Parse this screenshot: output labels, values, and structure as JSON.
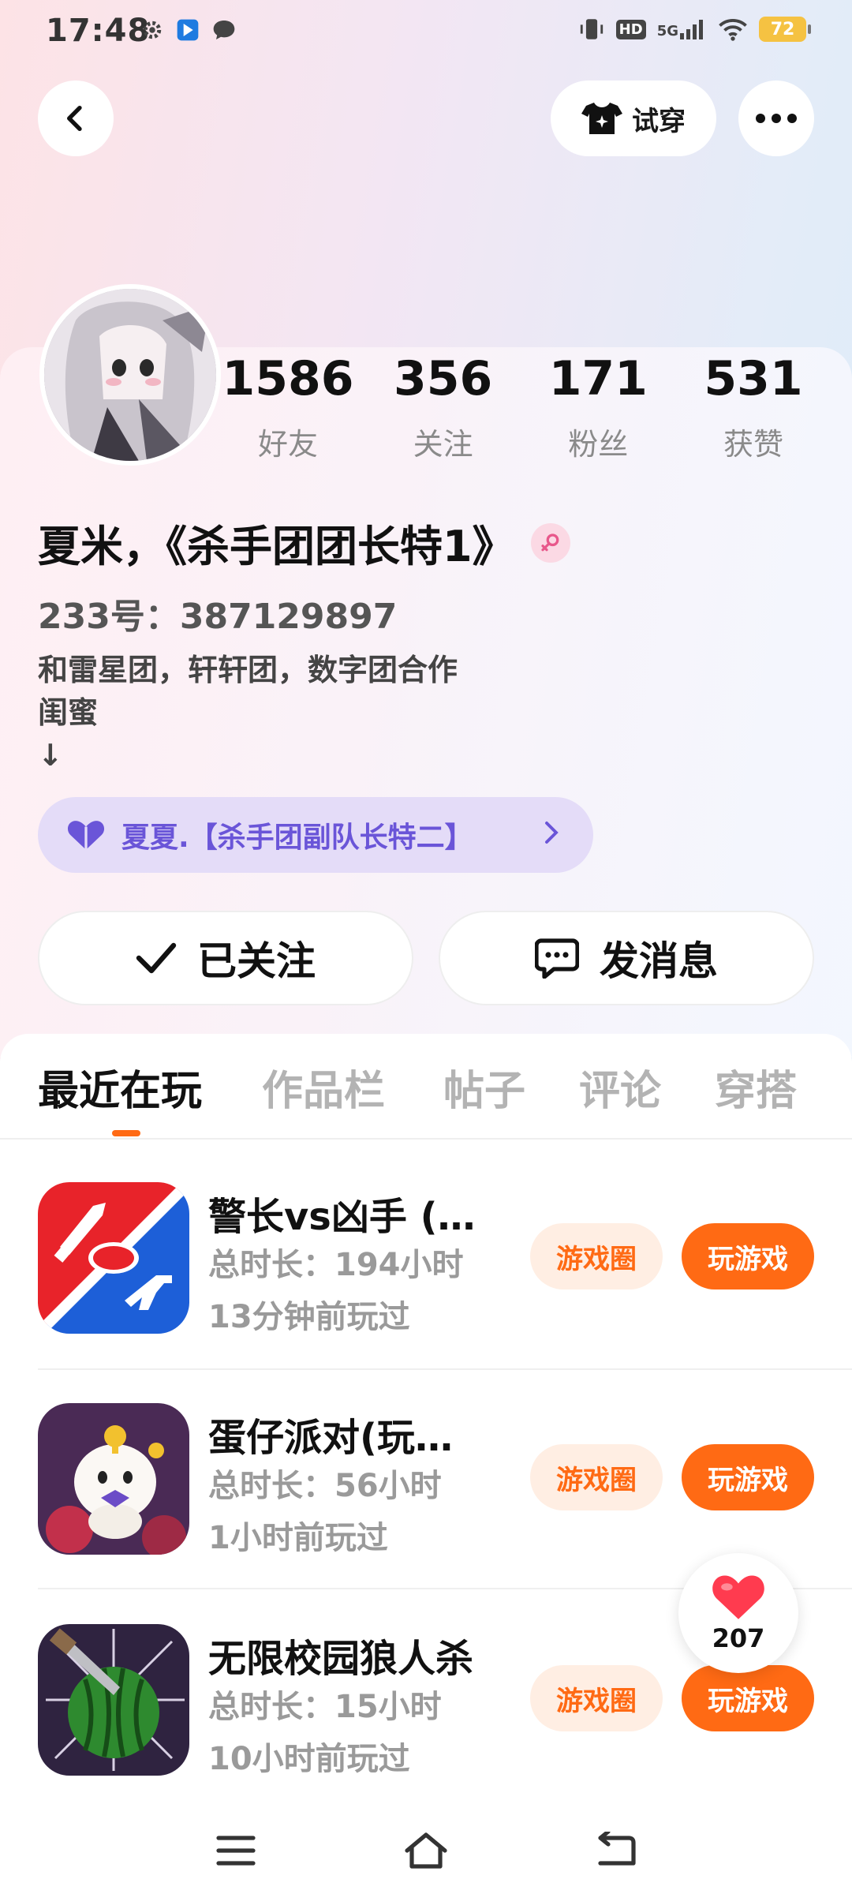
{
  "status_bar": {
    "time": "17:48",
    "battery": "72",
    "network": "5G",
    "hd": "HD"
  },
  "header": {
    "try_on_label": "试穿"
  },
  "stats": [
    {
      "value": "1586",
      "label": "好友"
    },
    {
      "value": "356",
      "label": "关注"
    },
    {
      "value": "171",
      "label": "粉丝"
    },
    {
      "value": "531",
      "label": "获赞"
    }
  ],
  "profile": {
    "username": "夏米，《杀手团团长特1》",
    "account_id": "233号：387129897",
    "bio_lines": [
      "和雷星团，轩轩团，数字团合作",
      "闺蜜",
      "↓"
    ],
    "cp_name": "夏夏.【杀手团副队长特二】"
  },
  "actions": {
    "follow_label": "已关注",
    "message_label": "发消息"
  },
  "tabs": [
    "最近在玩",
    "作品栏",
    "帖子",
    "评论",
    "穿搭"
  ],
  "games": [
    {
      "title": "警长vs凶手 (…",
      "playtime": "总时长：194小时",
      "last_played": "13分钟前玩过",
      "circle_label": "游戏圈",
      "play_label": "玩游戏"
    },
    {
      "title": "蛋仔派对(玩…",
      "playtime": "总时长：56小时",
      "last_played": "1小时前玩过",
      "circle_label": "游戏圈",
      "play_label": "玩游戏"
    },
    {
      "title": "无限校园狼人杀",
      "playtime": "总时长：15小时",
      "last_played": "10小时前玩过",
      "circle_label": "游戏圈",
      "play_label": "玩游戏"
    }
  ],
  "like_fab": {
    "count": "207"
  },
  "colors": {
    "accent": "#ff6a14",
    "cp_purple": "#6a55d8",
    "gender_pink": "#e8588b"
  }
}
